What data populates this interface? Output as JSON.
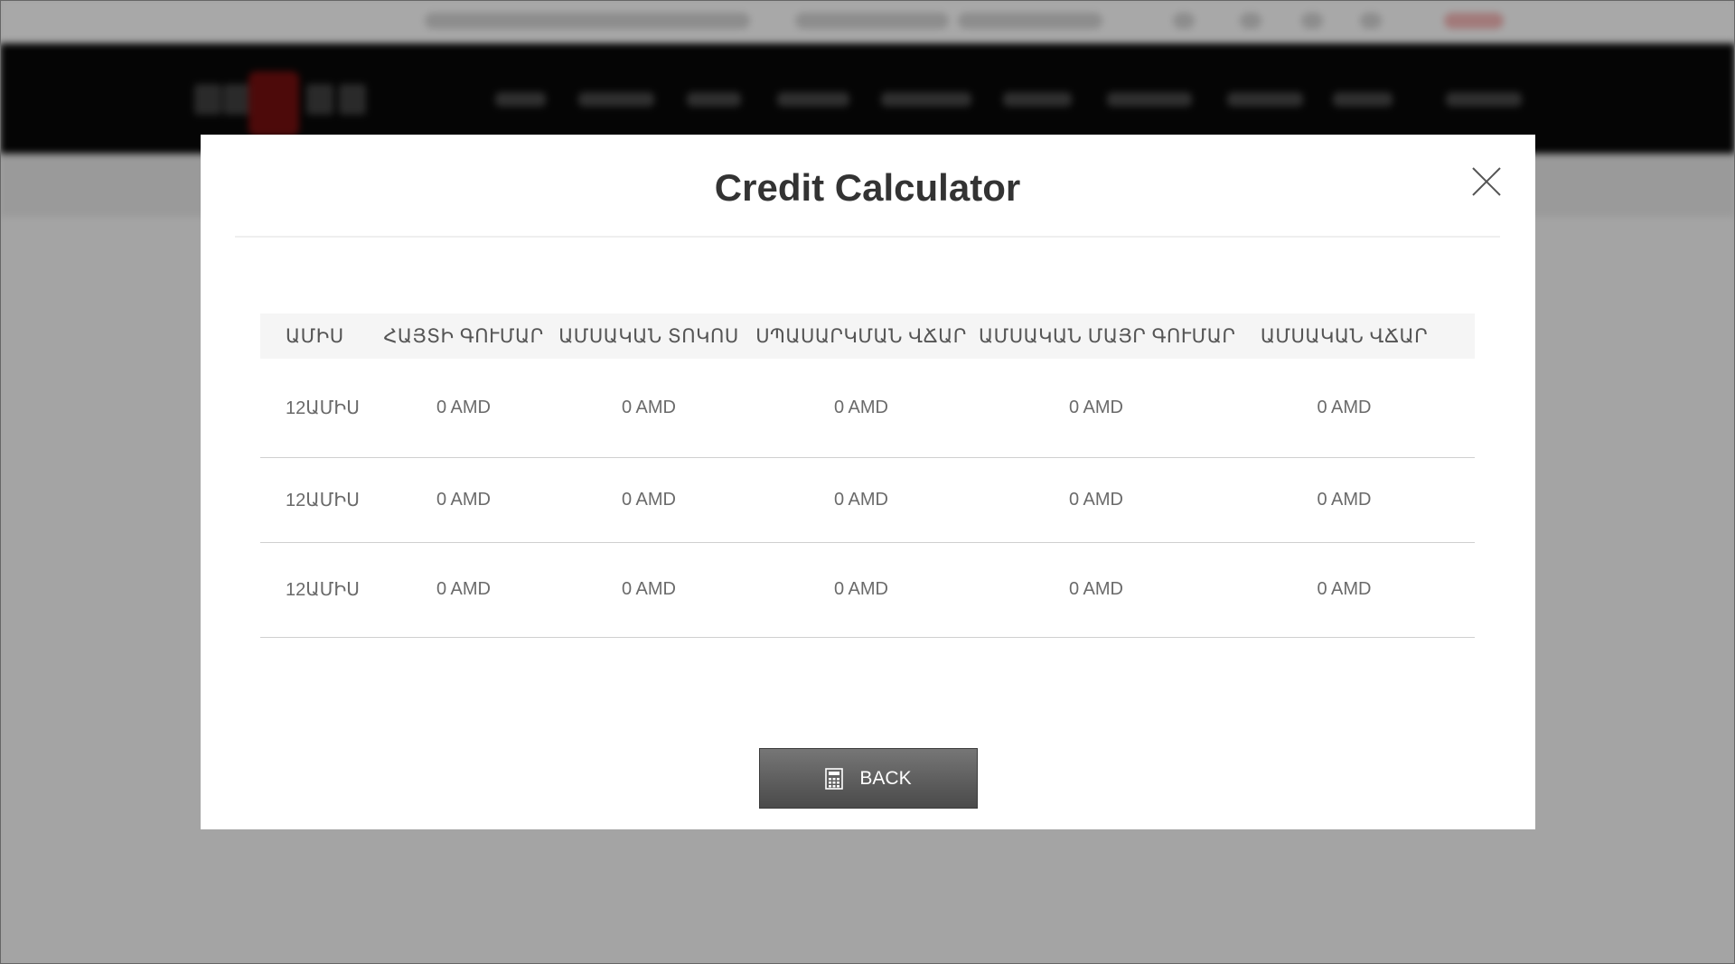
{
  "modal": {
    "title": "Credit Calculator",
    "close_icon": "close-icon",
    "back_label": "BACK",
    "back_icon": "calculator-icon"
  },
  "table": {
    "headers": [
      "ԱՄԻՍ",
      "ՀԱՅՏԻ ԳՈՒՄԱՐ",
      "ԱՄՍԱԿԱՆ ՏՈԿՈՍ",
      "ՍՊԱՍԱՐԿՄԱՆ ՎՃԱՐ",
      "ԱՄՍԱԿԱՆ ՄԱՅՐ ԳՈՒՄԱՐ",
      "ԱՄՍԱԿԱՆ ՎՃԱՐ"
    ],
    "rows": [
      [
        "12ԱՄԻՍ",
        "0 AMD",
        "0 AMD",
        "0 AMD",
        "0 AMD",
        "0 AMD"
      ],
      [
        "12ԱՄԻՍ",
        "0 AMD",
        "0 AMD",
        "0 AMD",
        "0 AMD",
        "0 AMD"
      ],
      [
        "12ԱՄԻՍ",
        "0 AMD",
        "0 AMD",
        "0 AMD",
        "0 AMD",
        "0 AMD"
      ]
    ]
  },
  "colors": {
    "backdrop": "#a4a4a4",
    "header_bg": "#050505",
    "button_bg": "#5a5a5a"
  }
}
